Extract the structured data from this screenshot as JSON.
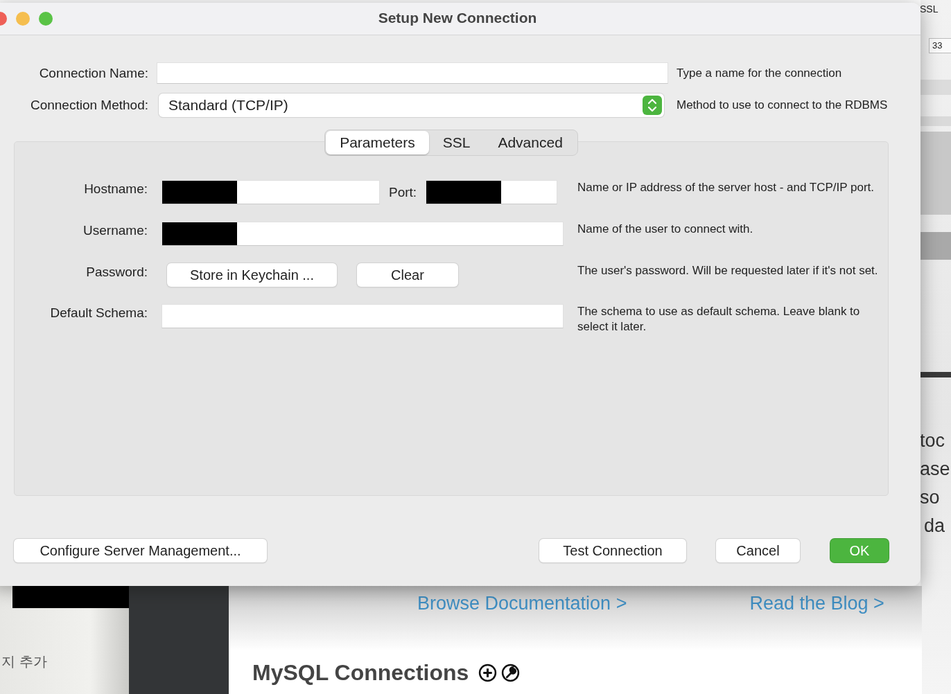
{
  "background_app": {
    "top_right_label": "SSL",
    "port_value": "33",
    "side_fragments": [
      "toc",
      "ase",
      "so",
      "da"
    ],
    "sidebar_fragment": "지 추가",
    "sidebar_redacted": true,
    "links": [
      "Browse Documentation >",
      "Read the Blog >"
    ],
    "heading": "MySQL Connections"
  },
  "window": {
    "title": "Setup New Connection"
  },
  "connection_name": {
    "label": "Connection Name:",
    "hint": "Type a name for the connection"
  },
  "connection_method": {
    "label": "Connection Method:",
    "value": "Standard (TCP/IP)",
    "hint": "Method to use to connect to the RDBMS"
  },
  "tabs": [
    {
      "label": "Parameters",
      "selected": true
    },
    {
      "label": "SSL",
      "selected": false
    },
    {
      "label": "Advanced",
      "selected": false
    }
  ],
  "parameters": [
    {
      "kind": "host_port",
      "label": "Hostname:",
      "redacted": true,
      "port_label": "Port:",
      "port_redacted": true,
      "hint": "Name or IP address of the server host - and TCP/IP port."
    },
    {
      "kind": "text",
      "label": "Username:",
      "redacted": true,
      "hint": "Name of the user to connect with."
    },
    {
      "kind": "buttons",
      "label": "Password:",
      "buttons": [
        "Store in Keychain ...",
        "Clear"
      ],
      "hint": "The user's password. Will be requested later if it's not set."
    },
    {
      "kind": "text",
      "label": "Default Schema:",
      "redacted": false,
      "hint": "The schema to use as default schema. Leave blank to select it later."
    }
  ],
  "buttons": [
    {
      "label": "Configure Server Management...",
      "kind": "default"
    },
    {
      "label": "Test Connection",
      "kind": "default"
    },
    {
      "label": "Cancel",
      "kind": "default"
    },
    {
      "label": "OK",
      "kind": "primary"
    }
  ]
}
